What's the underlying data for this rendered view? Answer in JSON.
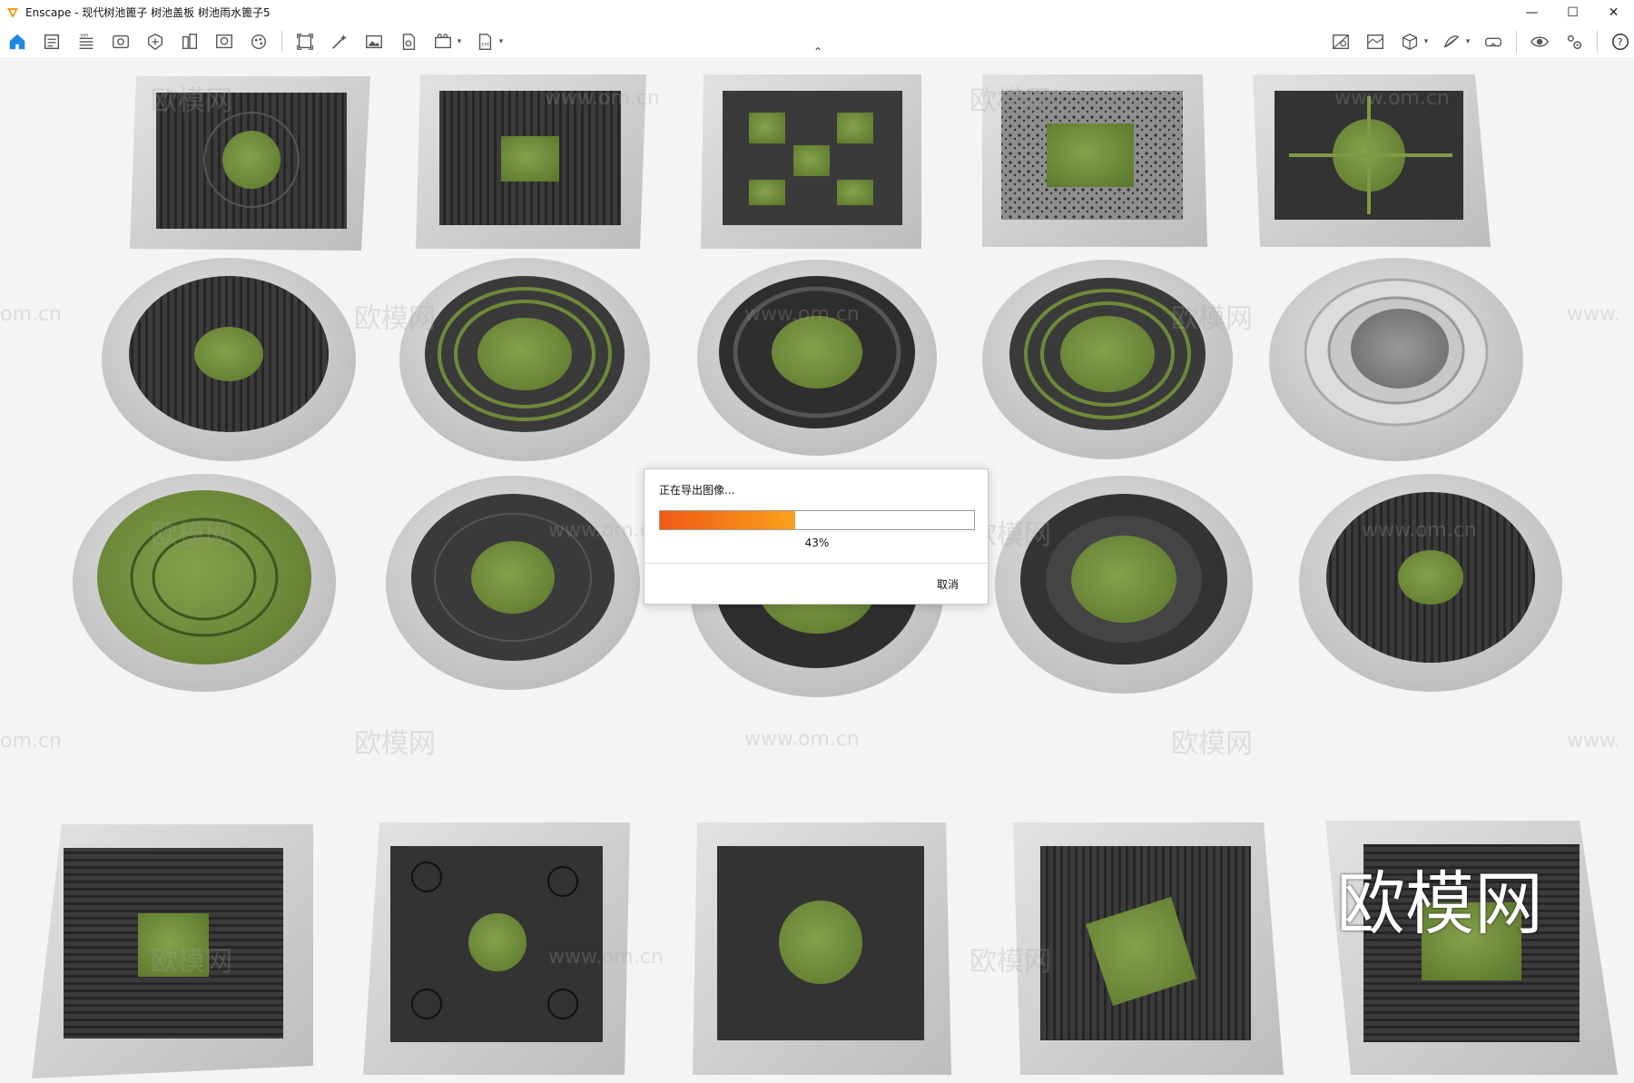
{
  "window": {
    "title": "Enscape - 现代树池篦子 树池盖板 树池雨水篦子5",
    "controls": {
      "minimize": "—",
      "maximize": "☐",
      "close": "✕"
    }
  },
  "toolbar": {
    "left_icons": [
      "home-icon",
      "project-info-icon",
      "bim-icon",
      "view-icon",
      "visual-settings-icon",
      "site-context-icon",
      "asset-library-icon",
      "material-editor-icon",
      "batch-render-icon",
      "render-icon",
      "screenshot-icon",
      "panorama-icon",
      "video-icon",
      "export-icon"
    ],
    "right_icons": [
      "view-management-icon",
      "render-settings-icon",
      "object-icon",
      "sketch-icon",
      "vr-headset-icon",
      "preview-eye-icon",
      "settings-icon",
      "help-icon"
    ],
    "collapse_toggle": "⌃"
  },
  "watermarks": {
    "brand": "欧模网",
    "domain": "www.om.cn",
    "domain_short": "om.cn",
    "domain_prefix": "www.",
    "big_brand": "欧模网"
  },
  "export_dialog": {
    "title": "正在导出图像...",
    "progress": 0.43,
    "progress_label": "43%",
    "cancel_label": "取消",
    "progress_colors": [
      "#f05a14",
      "#f9a21c"
    ]
  },
  "scene_colors": {
    "background": "#f4f4f4",
    "concrete": "#cfcfcf",
    "grate": "#3a3a3a",
    "grass": "#6e8a3a",
    "gravel": "#8a8a8a"
  }
}
